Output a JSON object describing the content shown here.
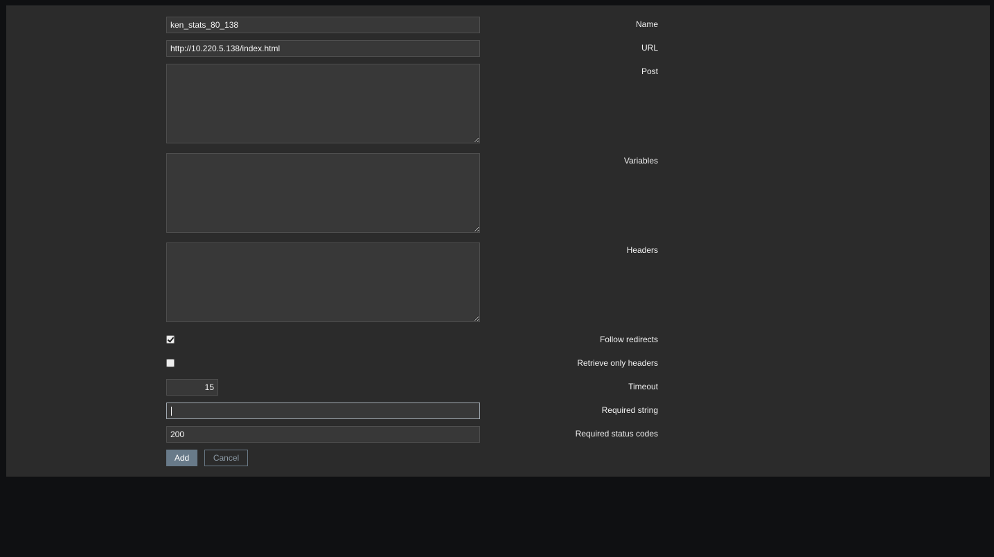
{
  "form": {
    "name": {
      "label": "Name",
      "value": "ken_stats_80_138"
    },
    "url": {
      "label": "URL",
      "value": "http://10.220.5.138/index.html"
    },
    "post": {
      "label": "Post",
      "value": ""
    },
    "variables": {
      "label": "Variables",
      "value": ""
    },
    "headers": {
      "label": "Headers",
      "value": ""
    },
    "follow_redirects": {
      "label": "Follow redirects",
      "checked": true
    },
    "retrieve_only_headers": {
      "label": "Retrieve only headers",
      "checked": false
    },
    "timeout": {
      "label": "Timeout",
      "value": "15"
    },
    "required_string": {
      "label": "Required string",
      "value": ""
    },
    "required_status_codes": {
      "label": "Required status codes",
      "value": "200"
    }
  },
  "buttons": {
    "add_label": "Add",
    "cancel_label": "Cancel"
  },
  "colors": {
    "background": "#0f1012",
    "panel": "#2b2b2b",
    "input": "#383838",
    "primary_button": "#687a89"
  }
}
